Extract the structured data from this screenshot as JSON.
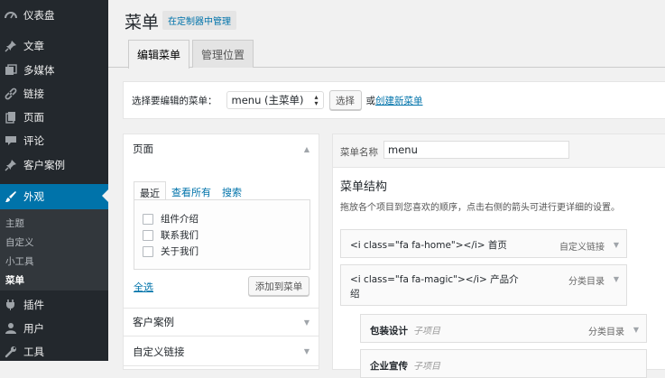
{
  "sidebar": {
    "items": [
      {
        "label": "仪表盘",
        "icon": "dashboard-icon"
      },
      {
        "label": "文章",
        "icon": "pin-icon"
      },
      {
        "label": "多媒体",
        "icon": "media-icon"
      },
      {
        "label": "链接",
        "icon": "link-icon"
      },
      {
        "label": "页面",
        "icon": "page-icon"
      },
      {
        "label": "评论",
        "icon": "comment-icon"
      },
      {
        "label": "客户案例",
        "icon": "pin-icon"
      },
      {
        "label": "外观",
        "icon": "brush-icon"
      },
      {
        "label": "插件",
        "icon": "plugin-icon"
      },
      {
        "label": "用户",
        "icon": "user-icon"
      },
      {
        "label": "工具",
        "icon": "wrench-icon"
      }
    ],
    "appearance_sub": [
      "主题",
      "自定义",
      "小工具",
      "菜单"
    ]
  },
  "header": {
    "title": "菜单",
    "customizer_badge": "在定制器中管理"
  },
  "tabs": [
    "编辑菜单",
    "管理位置"
  ],
  "select_bar": {
    "label": "选择要编辑的菜单：",
    "selected": "menu (主菜单)",
    "select_button": "选择",
    "or_text": "或",
    "create_link": "创建新菜单"
  },
  "left_panel": {
    "pages_title": "页面",
    "subtabs": [
      "最近",
      "查看所有",
      "搜索"
    ],
    "pages": [
      "组件介绍",
      "联系我们",
      "关于我们"
    ],
    "select_all": "全选",
    "add_button": "添加到菜单",
    "sections": [
      "客户案例",
      "自定义链接"
    ]
  },
  "right_panel": {
    "name_label": "菜单名称",
    "name_value": "menu",
    "structure_title": "菜单结构",
    "structure_desc": "拖放各个项目到您喜欢的顺序，点击右侧的箭头可进行更详细的设置。",
    "items": [
      {
        "title": "<i class=\"fa fa-home\"></i> 首页",
        "type": "自定义链接"
      },
      {
        "title_line1": "<i class=\"fa fa-magic\"></i> 产品介",
        "title_line2": "绍",
        "type": "分类目录"
      },
      {
        "title": "包装设计",
        "tag": "子项目",
        "type": "分类目录"
      },
      {
        "title": "企业宣传",
        "tag": "子项目"
      }
    ]
  },
  "colors": {
    "sidebar_bg": "#23282d",
    "active": "#0073aa",
    "link": "#0073aa"
  }
}
